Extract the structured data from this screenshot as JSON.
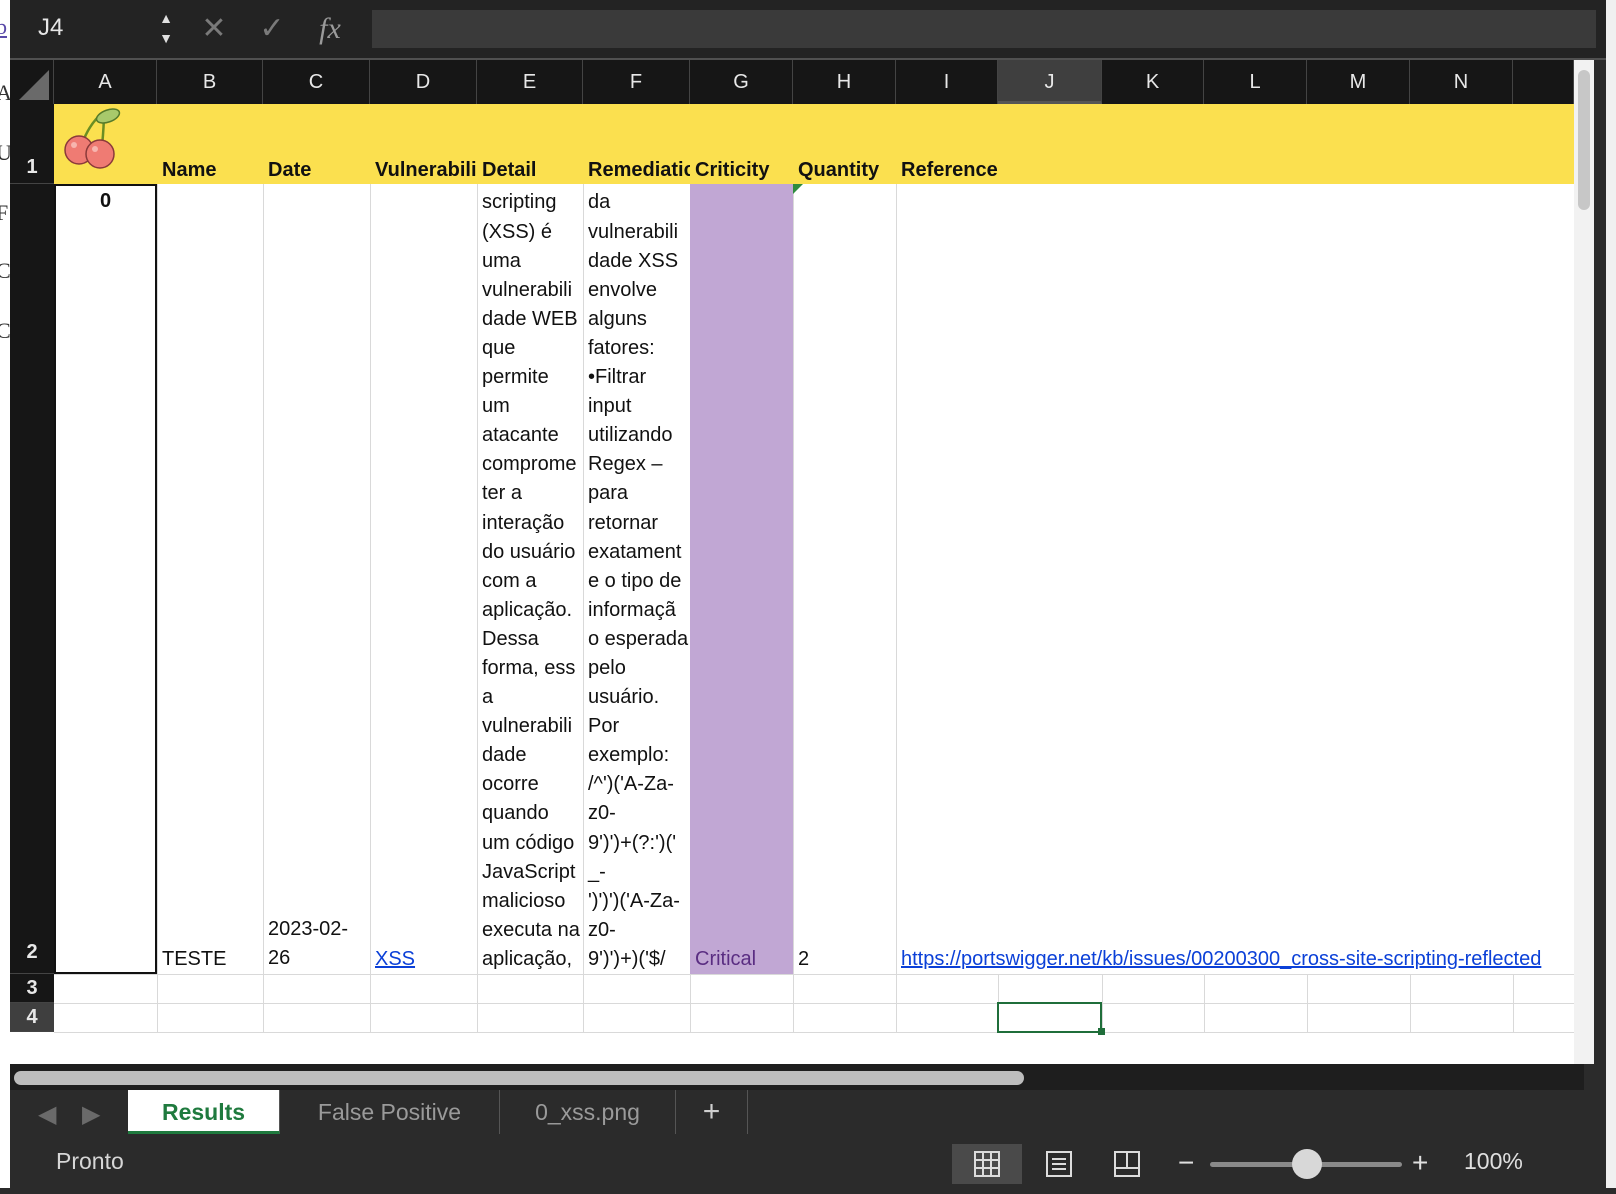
{
  "formula_bar": {
    "cell_reference": "J4",
    "cancel_glyph": "✕",
    "enter_glyph": "✓",
    "fx_label": "fx",
    "formula_value": ""
  },
  "left_strip_chars": [
    "b",
    "A",
    "U",
    "F",
    "C",
    "C"
  ],
  "columns": [
    "A",
    "B",
    "C",
    "D",
    "E",
    "F",
    "G",
    "H",
    "I",
    "J",
    "K",
    "L",
    "M",
    "N"
  ],
  "selected_column": "J",
  "rows": [
    "1",
    "2",
    "3",
    "4"
  ],
  "header_row": {
    "logo": "cherries",
    "name": "Name",
    "date": "Date",
    "vulnerability": "Vulnerabili",
    "detail": "Detail",
    "remediation": "Remediatic",
    "criticity": "Criticity",
    "quantity": "Quantity",
    "reference": "Reference"
  },
  "row2": {
    "a": "0",
    "b": "TESTE",
    "c": "2023-02-\n26",
    "d": "XSS",
    "e": "O Cross\nsite\nscripting\n(XSS) é\numa\nvulnerabili\ndade WEB\nque\npermite\num\natacante\ncomprome\nter a\ninteração\ndo usuário\ncom a\naplicação.\nDessa\nforma, essa\nvulnerabili\ndade\nocorre\nquando\num código\nJavaScript\nmalicioso\nexecuta na\naplicação,",
    "f": "A\nprevenção\nda\nvulnerabili\ndade XSS\nenvolve\nalguns\nfatores:\n•Filtrar\ninput\nutilizando\nRegex –\npara\nretornar\nexatament\ne o tipo de\ninformaçã\no esperada\npelo\nusuário.\nPor\nexemplo:\n/^')('A-Za-\nz0-\n9')')+(?:')(' _-\n')')')('A-Za-\nz0-\n9')')+)('$/",
    "g": "Critical",
    "h": "2",
    "i": "https://portswigger.net/kb/issues/00200300_cross-site-scripting-reflected"
  },
  "colors": {
    "header_fill": "#fbe04f",
    "criticity_fill": "#c1a7d4",
    "criticity_text": "#5a2d82",
    "link": "#0b40d8",
    "active_tab_text": "#1f7a3e"
  },
  "tabs": [
    "Results",
    "False Positive",
    "0_xss.png"
  ],
  "active_tab": "Results",
  "add_sheet_label": "+",
  "status": {
    "text": "Pronto",
    "zoom": "100%",
    "zoom_minus": "−",
    "zoom_plus": "+"
  }
}
